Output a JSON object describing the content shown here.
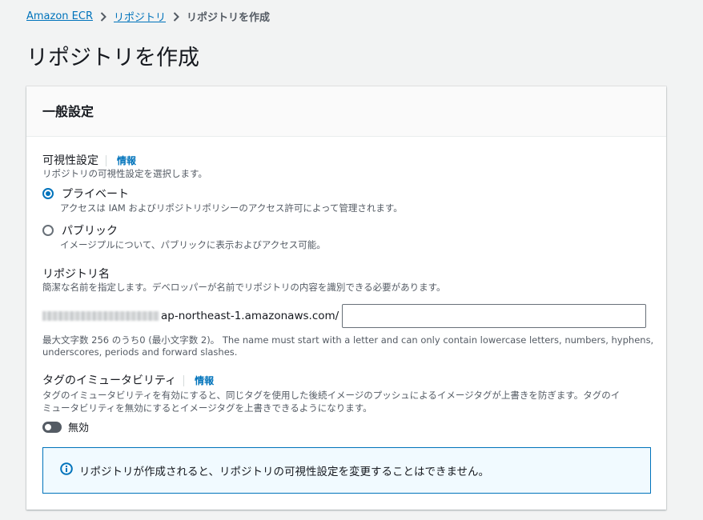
{
  "breadcrumb": {
    "items": [
      "Amazon ECR",
      "リポジトリ"
    ],
    "current": "リポジトリを作成"
  },
  "page": {
    "title": "リポジトリを作成"
  },
  "panel": {
    "title": "一般設定",
    "visibility": {
      "label": "可視性設定",
      "info": "情報",
      "description": "リポジトリの可視性設定を選択します。",
      "options": [
        {
          "label": "プライベート",
          "description": "アクセスは IAM およびリポジトリポリシーのアクセス許可によって管理されます。",
          "selected": true
        },
        {
          "label": "パブリック",
          "description": "イメージプルについて、パブリックに表示およびアクセス可能。",
          "selected": false
        }
      ]
    },
    "repo_name": {
      "label": "リポジトリ名",
      "description": "簡潔な名前を指定します。デベロッパーが名前でリポジトリの内容を識別できる必要があります。",
      "uri_suffix": "ap-northeast-1.amazonaws.com/",
      "value": "",
      "constraint_line1": "最大文字数 256 のうち0 (最小文字数 2)。 The name must start with a letter and can only contain lowercase letters, numbers, hyphens,",
      "constraint_line2": "underscores, periods and forward slashes."
    },
    "immutability": {
      "label": "タグのイミュータビリティ",
      "info": "情報",
      "description_line1": "タグのイミュータビリティを有効にすると、同じタグを使用した後続イメージのプッシュによるイメージタグが上書きを防ぎます。タグのイ",
      "description_line2": "ミュータビリティを無効にするとイメージタグを上書きできるようになります。",
      "toggle_label": "無効",
      "enabled": false
    },
    "alert": {
      "text": "リポジトリが作成されると、リポジトリの可視性設定を変更することはできません。"
    }
  },
  "colors": {
    "link": "#0073bb",
    "accent": "#0073bb",
    "alert_bg": "#f1faff"
  }
}
